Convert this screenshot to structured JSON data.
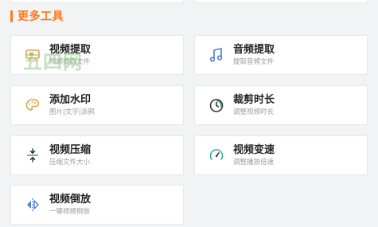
{
  "section": {
    "title": "更多工具"
  },
  "tools": [
    {
      "id": "extract-frames",
      "title": "视频提取",
      "desc": "视频提取文件",
      "icon": "video-frame-icon"
    },
    {
      "id": "extract-audio",
      "title": "音频提取",
      "desc": "提取音频文件",
      "icon": "music-note-icon"
    },
    {
      "id": "watermark",
      "title": "添加水印",
      "desc": "图片|文字|涂鸦",
      "icon": "palette-icon"
    },
    {
      "id": "trim",
      "title": "裁剪时长",
      "desc": "调整视频时长",
      "icon": "timer-icon"
    },
    {
      "id": "compress",
      "title": "视频压缩",
      "desc": "压缩文件大小",
      "icon": "compress-icon"
    },
    {
      "id": "speed",
      "title": "视频变速",
      "desc": "调整播放倍速",
      "icon": "speedometer-icon"
    },
    {
      "id": "reverse",
      "title": "视频倒放",
      "desc": "一键视频倒放",
      "icon": "mirror-flip-icon"
    }
  ],
  "watermark": {
    "text": "五四网"
  },
  "colors": {
    "accent": "#ff7a1a",
    "card_bg": "#ffffff",
    "page_bg": "#f2f3f5"
  }
}
